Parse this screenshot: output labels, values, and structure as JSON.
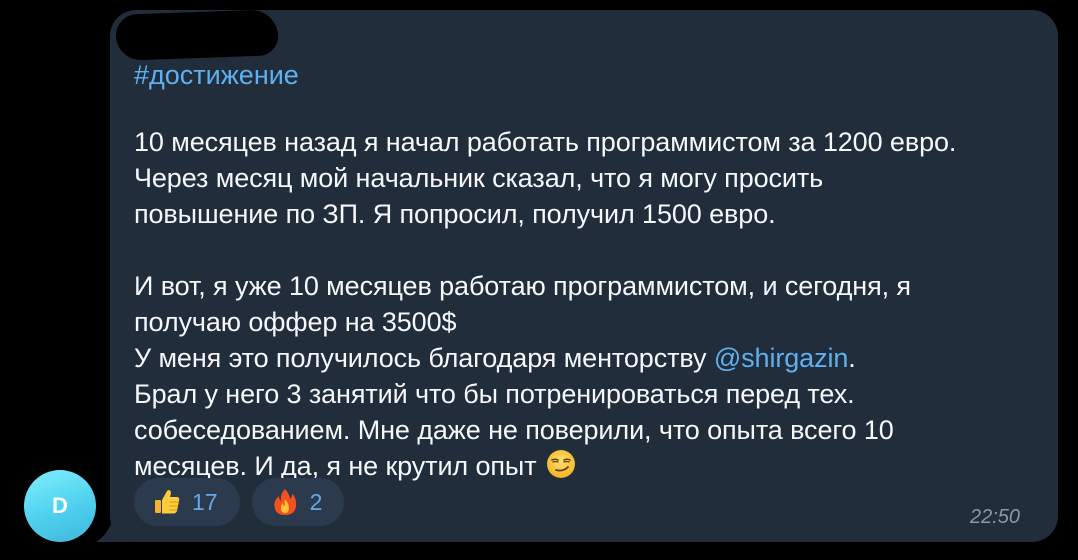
{
  "avatar": {
    "initial": "D"
  },
  "message": {
    "hashtag": "#достижение",
    "paragraph1": [
      "10 месяцев назад я начал работать программистом за 1200 евро.",
      "Через месяц мой начальник сказал, что я могу просить",
      "повышение по ЗП. Я попросил, получил 1500 евро."
    ],
    "paragraph2": [
      "И вот, я уже 10 месяцев работаю программистом, и сегодня, я",
      "получаю оффер на 3500$"
    ],
    "mention_line_prefix": "У меня это получилось благодаря менторству ",
    "mention": "@shirgazin",
    "mention_line_suffix": ".",
    "paragraph3": [
      "Брал у него 3 занятий что бы потренироваться перед тех.",
      "собеседованием. Мне даже не поверили, что опыта всего 10"
    ],
    "last_line": "месяцев. И да, я не крутил опыт",
    "last_line_emoji": "smirking-face-emoji",
    "time": "22:50"
  },
  "reactions": [
    {
      "emoji": "thumbs-up-emoji",
      "count": "17"
    },
    {
      "emoji": "fire-emoji",
      "count": "2"
    }
  ],
  "colors": {
    "background": "#000000",
    "bubble": "#212d3b",
    "link": "#5fb0f0",
    "text": "#f5f7fa",
    "reaction_bg": "#2b3b4d",
    "avatar": "#4fd0ee"
  }
}
